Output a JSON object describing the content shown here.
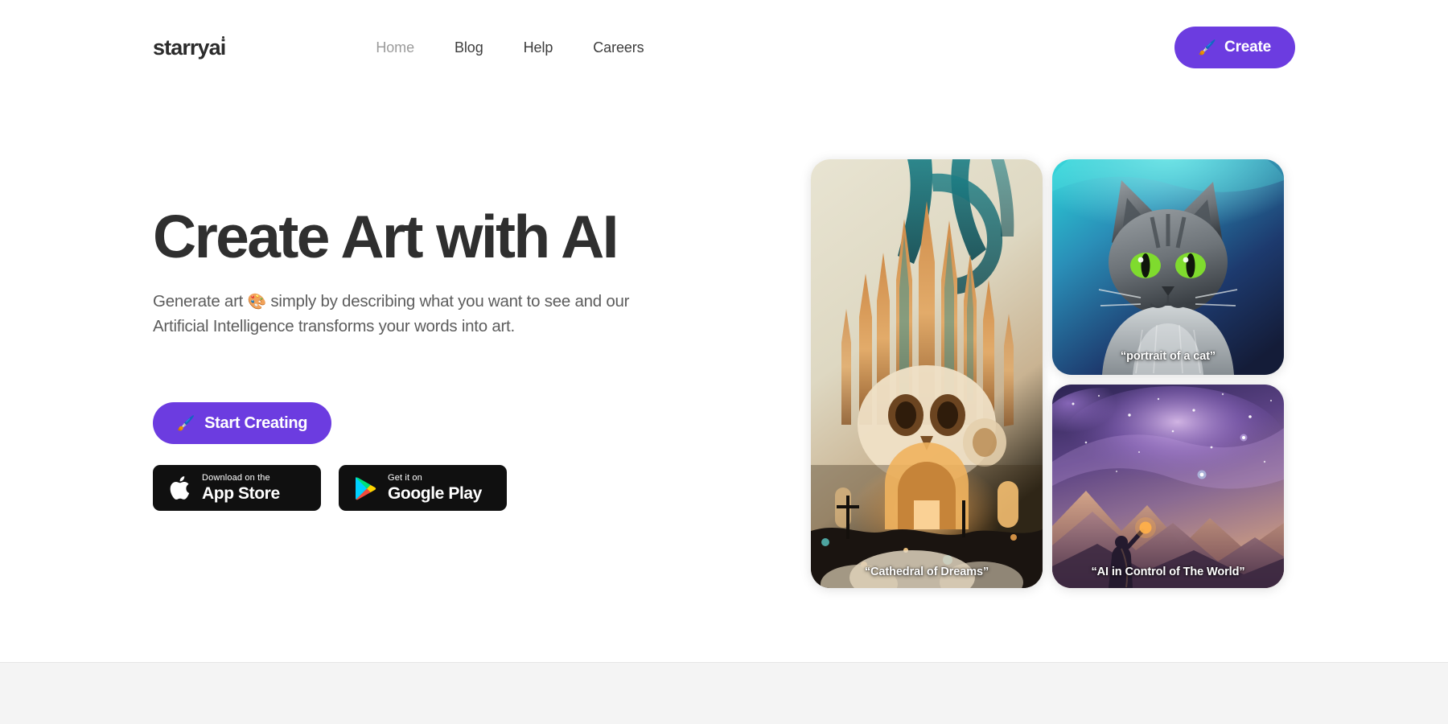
{
  "brand": {
    "logo_text": "starryai"
  },
  "header": {
    "nav": [
      {
        "label": "Home",
        "state": "inactive"
      },
      {
        "label": "Blog",
        "state": "active"
      },
      {
        "label": "Help",
        "state": "active"
      },
      {
        "label": "Careers",
        "state": "active"
      }
    ],
    "create_button": {
      "label": "Create",
      "icon": "paintbrush-emoji",
      "glyph": "🖌️"
    }
  },
  "hero": {
    "title": "Create Art with AI",
    "subtitle_part1": "Generate art",
    "subtitle_emoji": "🎨",
    "subtitle_part2": "simply by describing what you want to see and our Artificial Intelligence transforms your words into art.",
    "start_button": {
      "label": "Start Creating",
      "icon": "paintbrush-emoji",
      "glyph": "🖌️"
    },
    "stores": [
      {
        "small": "Download on the",
        "big": "App Store",
        "icon": "apple-icon"
      },
      {
        "small": "Get it on",
        "big": "Google Play",
        "icon": "google-play-icon"
      }
    ]
  },
  "gallery": {
    "cards": [
      {
        "caption": "“Cathedral of Dreams”",
        "name": "cathedral-of-dreams"
      },
      {
        "caption": "“portrait of a cat”",
        "name": "portrait-of-a-cat"
      },
      {
        "caption": "“AI in Control of The World”",
        "name": "ai-in-control-of-the-world"
      }
    ]
  },
  "colors": {
    "accent_purple": "#6c3ce0",
    "text_dark": "#2f2f2f",
    "text_muted": "#5d5d5d",
    "nav_inactive": "#9b9b9b",
    "badge_black": "#101010",
    "bottom_band": "#f4f4f4",
    "page_background": "#ffffff"
  }
}
